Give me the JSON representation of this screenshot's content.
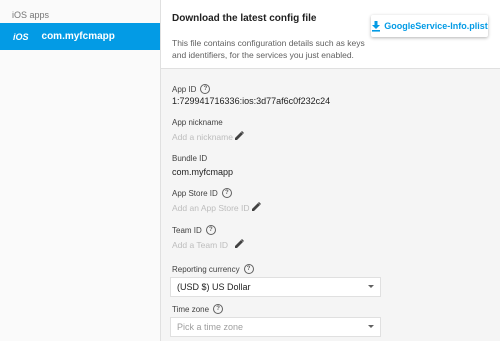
{
  "sidebar": {
    "heading": "iOS apps",
    "items": [
      {
        "badge": "iOS",
        "label": "com.myfcmapp"
      }
    ]
  },
  "config": {
    "title": "Download the latest config file",
    "description": "This file contains configuration details such as keys and identifiers, for the services you just enabled.",
    "download_label": "GoogleService-Info.plist"
  },
  "fields": {
    "app_id": {
      "label": "App ID",
      "value": "1:729941716336:ios:3d77af6c0f232c24"
    },
    "app_nickname": {
      "label": "App nickname",
      "placeholder": "Add a nickname"
    },
    "bundle_id": {
      "label": "Bundle ID",
      "value": "com.myfcmapp"
    },
    "app_store_id": {
      "label": "App Store ID",
      "placeholder": "Add an App Store ID"
    },
    "team_id": {
      "label": "Team ID",
      "placeholder": "Add a Team ID"
    },
    "reporting_currency": {
      "label": "Reporting currency",
      "value": "(USD $) US Dollar"
    },
    "time_zone": {
      "label": "Time zone",
      "placeholder": "Pick a time zone"
    }
  },
  "colors": {
    "accent": "#039be5",
    "sidebar_bg": "#fafafa",
    "details_bg": "#f5f5f5"
  },
  "icons": {
    "download": "download-icon",
    "help": "help-circle-icon",
    "edit": "pencil-icon",
    "dropdown": "chevron-down-icon"
  }
}
